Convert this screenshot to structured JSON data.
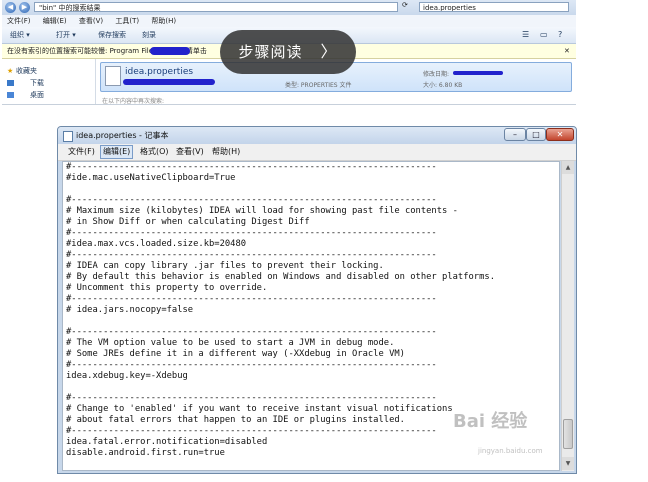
{
  "explorer": {
    "address_path": "\"bin\" 中的搜索结果",
    "search_text": "idea.properties",
    "menus": [
      "文件(F)",
      "编辑(E)",
      "查看(V)",
      "工具(T)",
      "帮助(H)"
    ],
    "toolbar": {
      "organize": "组织 ▾",
      "open": "打开 ▾",
      "save_search": "保存搜索",
      "burn": "刻录"
    },
    "infobar_text": "在没有索引的位置搜索可能较慢: Program Files\\...\\bin。请单击",
    "nav": {
      "favorites": "收藏夹",
      "downloads": "下载",
      "desktop": "桌面"
    },
    "file": {
      "name": "idea.properties",
      "type": "类型: PROPERTIES 文件",
      "modified": "修改日期:",
      "size": "大小: 6.80 KB"
    },
    "search_again": "在以下内容中再次搜索:"
  },
  "overlay": {
    "label": "步骤阅读",
    "chevron": "〉"
  },
  "notepad": {
    "title": "idea.properties - 记事本",
    "menus": [
      "文件(F)",
      "编辑(E)",
      "格式(O)",
      "查看(V)",
      "帮助(H)"
    ],
    "controls": {
      "minimize": "–",
      "maximize": "□",
      "close": "✕"
    },
    "content": "#---------------------------------------------------------------------\n#ide.mac.useNativeClipboard=True\n\n#---------------------------------------------------------------------\n# Maximum size (kilobytes) IDEA will load for showing past file contents -\n# in Show Diff or when calculating Digest Diff\n#---------------------------------------------------------------------\n#idea.max.vcs.loaded.size.kb=20480\n#---------------------------------------------------------------------\n# IDEA can copy library .jar files to prevent their locking.\n# By default this behavior is enabled on Windows and disabled on other platforms.\n# Uncomment this property to override.\n#---------------------------------------------------------------------\n# idea.jars.nocopy=false\n\n#---------------------------------------------------------------------\n# The VM option value to be used to start a JVM in debug mode.\n# Some JREs define it in a different way (-XXdebug in Oracle VM)\n#---------------------------------------------------------------------\nidea.xdebug.key=-Xdebug\n\n#---------------------------------------------------------------------\n# Change to 'enabled' if you want to receive instant visual notifications\n# about fatal errors that happen to an IDE or plugins installed.\n#---------------------------------------------------------------------\nidea.fatal.error.notification=disabled\ndisable.android.first.run=true"
  },
  "watermark": {
    "brand": "Bai 经验",
    "url": "jingyan.baidu.com"
  }
}
